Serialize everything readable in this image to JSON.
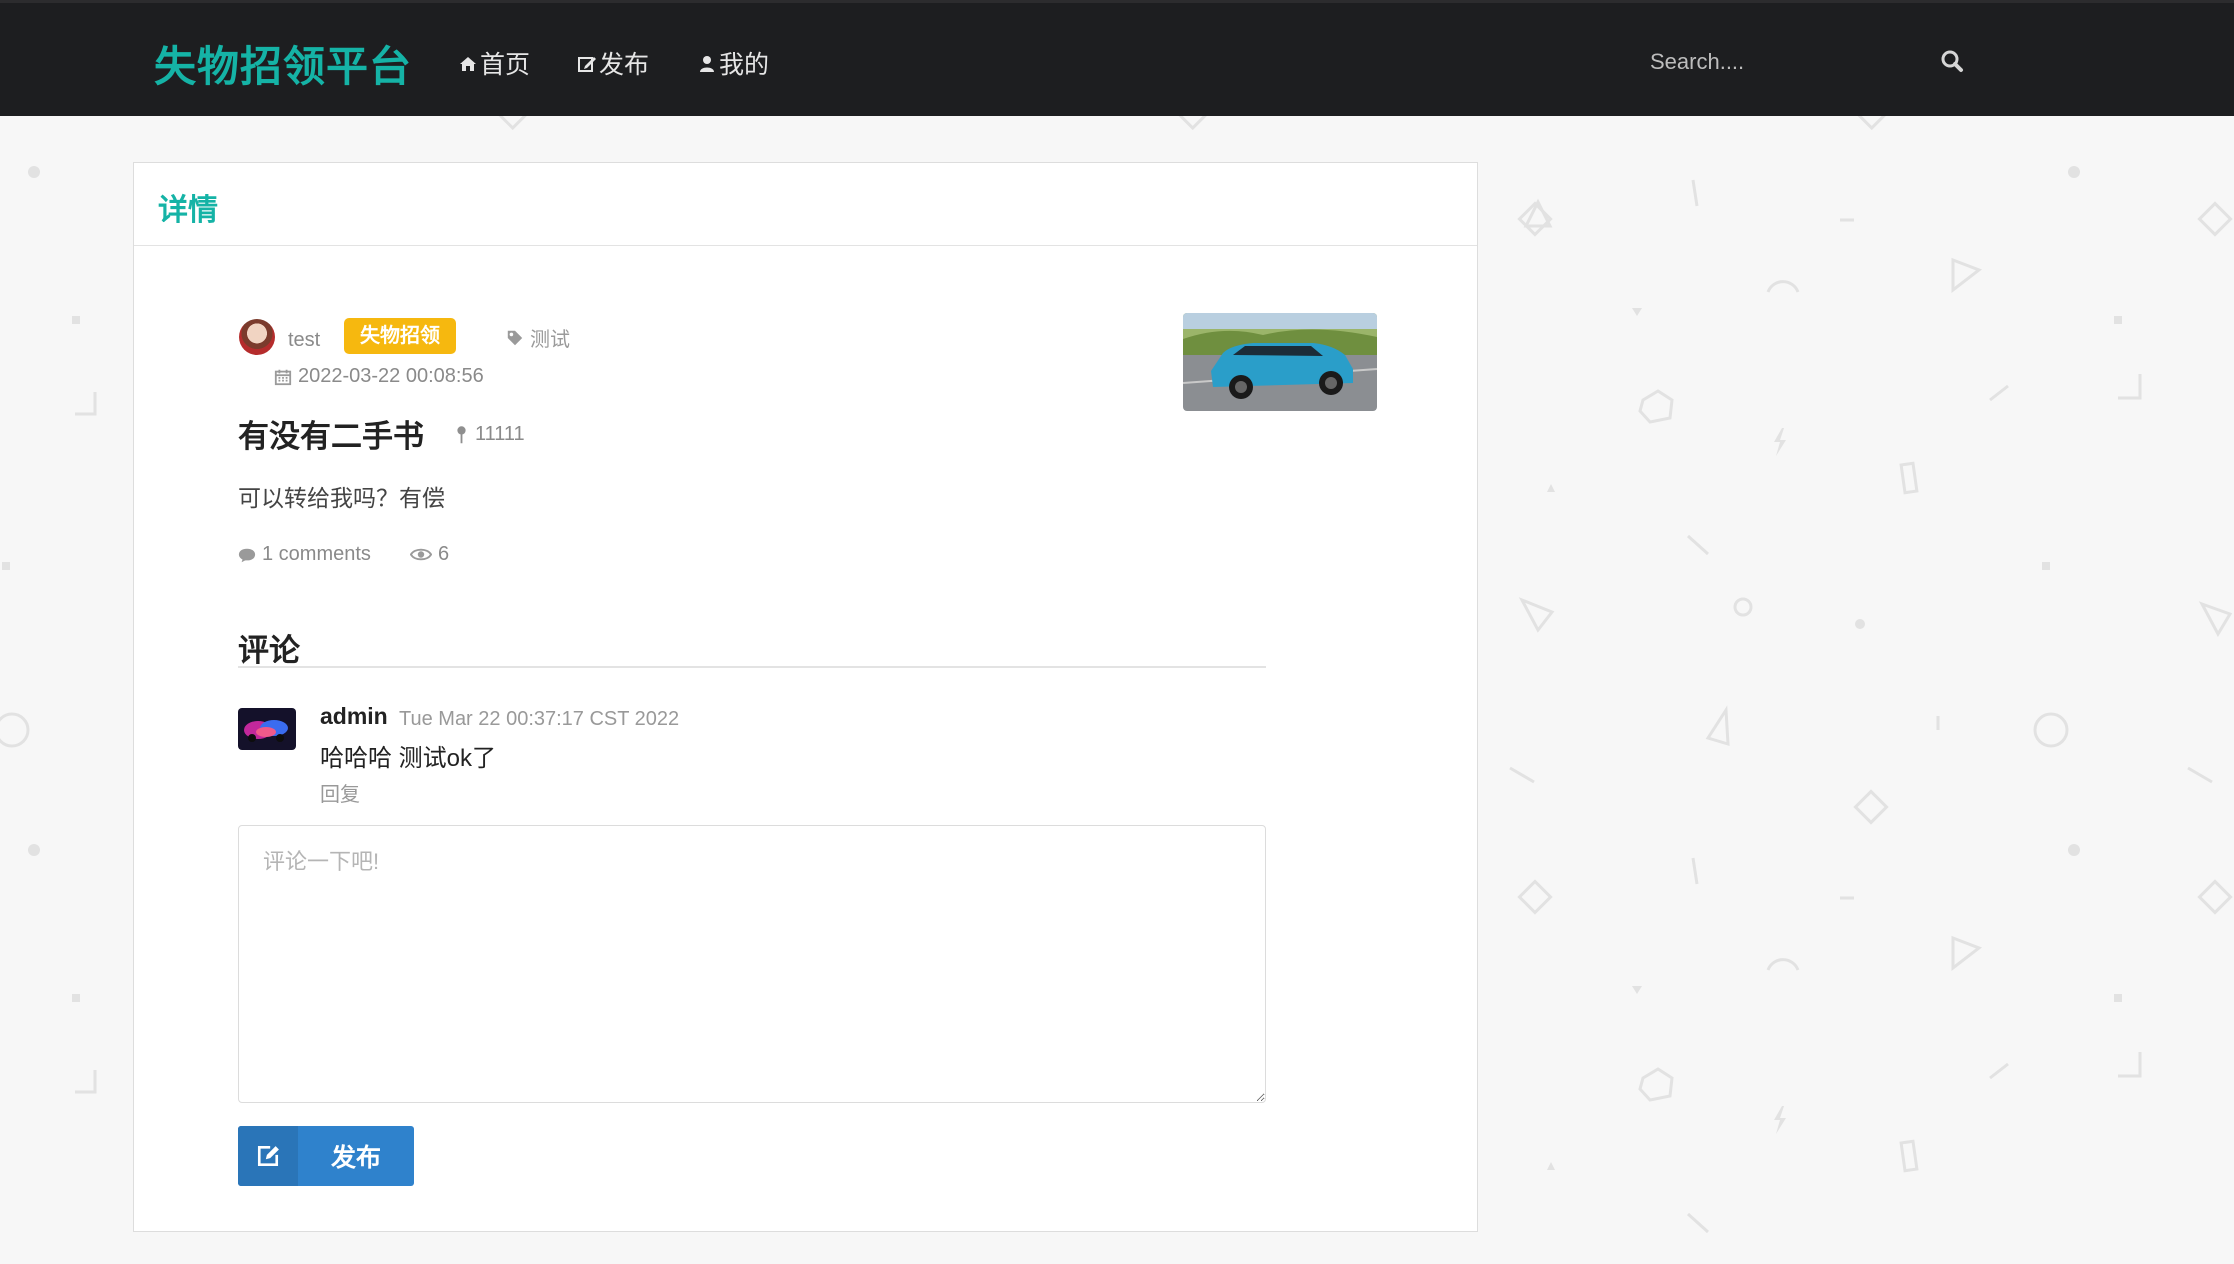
{
  "navbar": {
    "brand": "失物招领平台",
    "items": [
      {
        "label": "首页",
        "icon": "home-icon"
      },
      {
        "label": "发布",
        "icon": "edit-icon"
      },
      {
        "label": "我的",
        "icon": "user-icon"
      }
    ],
    "search_placeholder": "Search....",
    "search_icon": "search-icon"
  },
  "panel": {
    "title": "详情"
  },
  "post": {
    "author": "test",
    "category": "失物招领",
    "tag": "测试",
    "date": "2022-03-22 00:08:56",
    "title": "有没有二手书",
    "location": "11111",
    "body": "可以转给我吗？有偿",
    "comments_count": "1 comments",
    "views": "6"
  },
  "comments": {
    "heading": "评论",
    "items": [
      {
        "author": "admin",
        "time": "Tue Mar 22 00:37:17 CST 2022",
        "text": "哈哈哈 测试ok了",
        "reply_label": "回复"
      }
    ],
    "input_placeholder": "评论一下吧!",
    "submit_label": "发布"
  },
  "colors": {
    "accent": "#15b3a6",
    "navbar_bg": "#1d1e20",
    "badge": "#f6b80f",
    "button": "#2f82cc"
  }
}
